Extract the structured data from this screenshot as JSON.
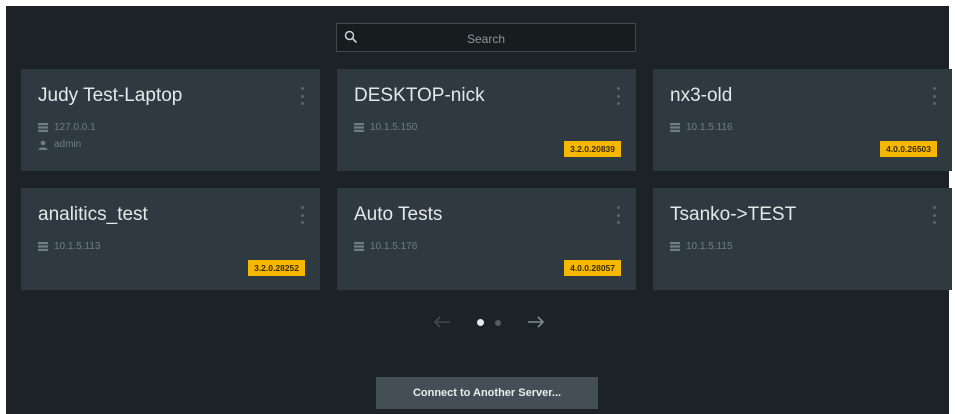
{
  "search": {
    "placeholder": "Search"
  },
  "servers": [
    {
      "name": "Judy Test-Laptop",
      "address": "127.0.0.1",
      "user": "admin",
      "version": ""
    },
    {
      "name": "DESKTOP-nick",
      "address": "10.1.5.150",
      "user": "",
      "version": "3.2.0.20839"
    },
    {
      "name": "nx3-old",
      "address": "10.1.5.116",
      "user": "",
      "version": "4.0.0.26503"
    },
    {
      "name": "analitics_test",
      "address": "10.1.5.113",
      "user": "",
      "version": "3.2.0.28252"
    },
    {
      "name": "Auto Tests",
      "address": "10.1.5.176",
      "user": "",
      "version": "4.0.0.28057"
    },
    {
      "name": "Tsanko->TEST",
      "address": "10.1.5.115",
      "user": "",
      "version": ""
    }
  ],
  "pagination": {
    "page_count": 2,
    "current_page": 1
  },
  "connect_button": {
    "label": "Connect to Another Server..."
  },
  "colors": {
    "background": "#1c2226",
    "tile": "#2e3a40",
    "badge": "#f5b700",
    "active_dot": "#e3e8ea",
    "inactive": "#4f5c63"
  },
  "icons": [
    "search-icon",
    "server-icon",
    "user-icon",
    "more-vertical-icon",
    "arrow-left-icon",
    "arrow-right-icon"
  ]
}
